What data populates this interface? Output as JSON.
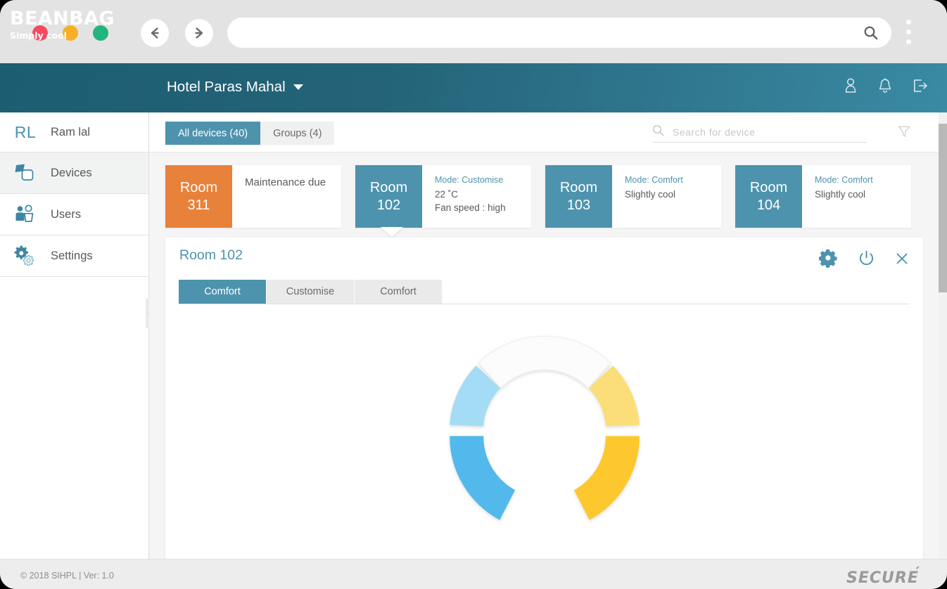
{
  "browser": {
    "traffic_lights": [
      "close",
      "minimize",
      "maximize"
    ],
    "back_label": "Back",
    "forward_label": "Forward",
    "url_value": "",
    "url_placeholder": "",
    "search_icon": "search-icon",
    "menu_icon": "kebab-menu-icon"
  },
  "header": {
    "brand_name": "BEANBAG",
    "brand_tagline": "Simply cool",
    "property_name": "Hotel Paras Mahal",
    "icons": [
      "user-icon",
      "bell-icon",
      "logout-icon"
    ],
    "bg_color": "#246378"
  },
  "sidebar": {
    "user": {
      "initials": "RL",
      "name": "Ram lal"
    },
    "items": [
      {
        "label": "Devices",
        "icon": "devices-icon",
        "active": true
      },
      {
        "label": "Users",
        "icon": "users-icon",
        "active": false
      },
      {
        "label": "Settings",
        "icon": "settings-gears-icon",
        "active": false
      }
    ],
    "collapse_label": "Collapse sidebar"
  },
  "toolbar": {
    "tabs": [
      {
        "label": "All devices (40)",
        "active": true
      },
      {
        "label": "Groups (4)",
        "active": false
      }
    ],
    "search_value": "",
    "search_placeholder": "Search for device",
    "filter_icon": "filter-funnel-icon"
  },
  "devices": [
    {
      "room": "Room",
      "number": "311",
      "badge_color": "#e8813a",
      "status": "Maintenance due",
      "mode": "",
      "temperature": "",
      "fan_speed": "",
      "selected": false
    },
    {
      "room": "Room",
      "number": "102",
      "badge_color": "#4d93ad",
      "status": "",
      "mode": "Mode: Customise",
      "temperature": "22 ˚C",
      "fan_speed": "Fan speed : high",
      "selected": true
    },
    {
      "room": "Room",
      "number": "103",
      "badge_color": "#4d93ad",
      "status": "Slightly cool",
      "mode": "Mode: Comfort",
      "temperature": "",
      "fan_speed": "",
      "selected": false
    },
    {
      "room": "Room",
      "number": "104",
      "badge_color": "#4d93ad",
      "status": "Slightly cool",
      "mode": "Mode: Comfort",
      "temperature": "",
      "fan_speed": "",
      "selected": false
    }
  ],
  "detail": {
    "title": "Room 102",
    "actions": [
      "settings-gear-icon",
      "power-icon",
      "close-icon"
    ],
    "tabs": [
      {
        "label": "Comfort",
        "active": true
      },
      {
        "label": "Customise",
        "active": false
      },
      {
        "label": "Comfort",
        "active": false
      }
    ],
    "dial": {
      "segments": [
        {
          "name": "empty-top",
          "color": "#fcfcfc",
          "start_deg": -36,
          "end_deg": 36
        },
        {
          "name": "light-yellow",
          "color": "#fbde79",
          "start_deg": 38,
          "end_deg": 110
        },
        {
          "name": "deep-yellow",
          "color": "#fdc82f",
          "start_deg": 112,
          "end_deg": 176
        },
        {
          "name": "deep-blue",
          "color": "#52b8ec",
          "start_deg": 184,
          "end_deg": 248
        },
        {
          "name": "light-blue",
          "color": "#a5dcf5",
          "start_deg": 250,
          "end_deg": 322
        }
      ]
    }
  },
  "footer": {
    "copyright": "© 2018 SIHPL  |   Ver: 1.0",
    "logo_text": "SECURE"
  }
}
